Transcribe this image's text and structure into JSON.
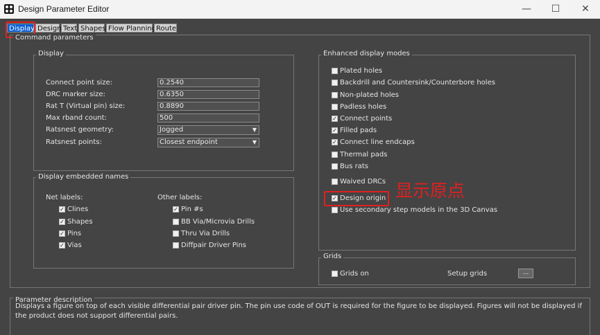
{
  "window": {
    "title": "Design Parameter Editor",
    "minimize": "—",
    "maximize": "☐",
    "close": "✕"
  },
  "tabs": [
    {
      "label": "Display",
      "active": true
    },
    {
      "label": "Design"
    },
    {
      "label": "Text"
    },
    {
      "label": "Shapes"
    },
    {
      "label": "Flow Planning"
    },
    {
      "label": "Route"
    }
  ],
  "command_parameters": {
    "legend": "Command parameters",
    "display": {
      "legend": "Display",
      "fields": [
        {
          "label": "Connect point size:",
          "value": "0.2540"
        },
        {
          "label": "DRC marker size:",
          "value": "0.6350"
        },
        {
          "label": "Rat T (Virtual pin) size:",
          "value": "0.8890"
        },
        {
          "label": "Max rband count:",
          "value": "500"
        }
      ],
      "selects": [
        {
          "label": "Ratsnest geometry:",
          "value": "Jogged"
        },
        {
          "label": "Ratsnest points:",
          "value": "Closest endpoint"
        }
      ]
    },
    "embedded_names": {
      "legend": "Display embedded names",
      "net_labels_title": "Net labels:",
      "net_labels": [
        {
          "label": "Clines",
          "checked": true
        },
        {
          "label": "Shapes",
          "checked": true
        },
        {
          "label": "Pins",
          "checked": true
        },
        {
          "label": "Vias",
          "checked": true
        }
      ],
      "other_labels_title": "Other labels:",
      "other_labels": [
        {
          "label": "Pin #s",
          "checked": true
        },
        {
          "label": "BB Via/Microvia Drills",
          "checked": false
        },
        {
          "label": "Thru Via Drills",
          "checked": false
        },
        {
          "label": "Diffpair Driver Pins",
          "checked": false
        }
      ]
    },
    "enhanced_modes": {
      "legend": "Enhanced display modes",
      "items": [
        {
          "label": "Plated holes",
          "checked": false
        },
        {
          "label": "Backdrill and Countersink/Counterbore holes",
          "checked": false
        },
        {
          "label": "Non-plated holes",
          "checked": false
        },
        {
          "label": "Padless holes",
          "checked": false
        },
        {
          "label": "Connect points",
          "checked": true
        },
        {
          "label": "Filled pads",
          "checked": true
        },
        {
          "label": "Connect line endcaps",
          "checked": true
        },
        {
          "label": "Thermal pads",
          "checked": false
        },
        {
          "label": "Bus rats",
          "checked": false
        },
        {
          "label": "Waived DRCs",
          "checked": false
        },
        {
          "label": "Design origin",
          "checked": true
        },
        {
          "label": "Use secondary step models in the 3D Canvas",
          "checked": false
        }
      ]
    },
    "grids": {
      "legend": "Grids",
      "grids_on_label": "Grids on",
      "grids_on_checked": false,
      "setup_label": "Setup grids",
      "setup_button": "..."
    }
  },
  "parameter_description": {
    "legend": "Parameter description",
    "text": "Displays a figure on top of each visible differential pair driver pin.  The pin use code of OUT is required for the figure to be displayed.  Figures will not be displayed if the product does not support differential pairs."
  },
  "annotation": {
    "text": "显示原点",
    "color": "#e02020"
  }
}
